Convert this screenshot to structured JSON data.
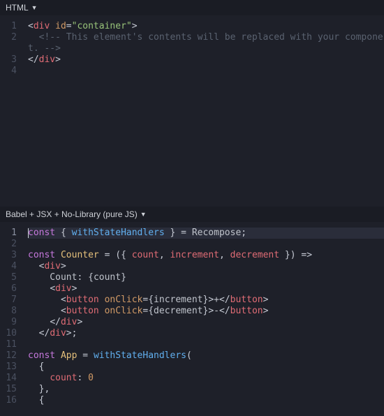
{
  "panel1": {
    "title": "HTML",
    "lines": [
      {
        "n": "1",
        "tokens": [
          [
            "t-punc",
            "<"
          ],
          [
            "t-tag",
            "div"
          ],
          [
            "t-plain",
            " "
          ],
          [
            "t-attr",
            "id"
          ],
          [
            "t-op",
            "="
          ],
          [
            "t-str",
            "\"container\""
          ],
          [
            "t-punc",
            ">"
          ]
        ]
      },
      {
        "n": "2",
        "tokens": [
          [
            "t-plain",
            "  "
          ],
          [
            "t-cmt",
            "<!-- This element's contents will be replaced with your componen"
          ]
        ]
      },
      {
        "n": "",
        "tokens": [
          [
            "t-cmt",
            "t. -->"
          ]
        ]
      },
      {
        "n": "3",
        "tokens": [
          [
            "t-punc",
            "</"
          ],
          [
            "t-tag",
            "div"
          ],
          [
            "t-punc",
            ">"
          ]
        ]
      },
      {
        "n": "4",
        "tokens": []
      }
    ]
  },
  "panel2": {
    "title": "Babel + JSX + No-Library (pure JS)",
    "lines": [
      {
        "n": "1",
        "active": true,
        "cursor": true,
        "tokens": [
          [
            "t-kw",
            "const"
          ],
          [
            "t-plain",
            " "
          ],
          [
            "t-punc",
            "{"
          ],
          [
            "t-plain",
            " "
          ],
          [
            "t-fn",
            "withStateHandlers"
          ],
          [
            "t-plain",
            " "
          ],
          [
            "t-punc",
            "}"
          ],
          [
            "t-plain",
            " "
          ],
          [
            "t-op",
            "="
          ],
          [
            "t-plain",
            " Recompose"
          ],
          [
            "t-punc",
            ";"
          ]
        ]
      },
      {
        "n": "2",
        "tokens": []
      },
      {
        "n": "3",
        "tokens": [
          [
            "t-kw",
            "const"
          ],
          [
            "t-plain",
            " "
          ],
          [
            "t-fn2",
            "Counter"
          ],
          [
            "t-plain",
            " "
          ],
          [
            "t-op",
            "="
          ],
          [
            "t-plain",
            " "
          ],
          [
            "t-punc",
            "({"
          ],
          [
            "t-plain",
            " "
          ],
          [
            "t-name",
            "count"
          ],
          [
            "t-punc",
            ","
          ],
          [
            "t-plain",
            " "
          ],
          [
            "t-name",
            "increment"
          ],
          [
            "t-punc",
            ","
          ],
          [
            "t-plain",
            " "
          ],
          [
            "t-name",
            "decrement"
          ],
          [
            "t-plain",
            " "
          ],
          [
            "t-punc",
            "})"
          ],
          [
            "t-plain",
            " "
          ],
          [
            "t-op",
            "=>"
          ]
        ]
      },
      {
        "n": "4",
        "tokens": [
          [
            "t-plain",
            "  "
          ],
          [
            "t-punc",
            "<"
          ],
          [
            "t-tag",
            "div"
          ],
          [
            "t-punc",
            ">"
          ]
        ]
      },
      {
        "n": "5",
        "tokens": [
          [
            "t-plain",
            "    Count"
          ],
          [
            "t-punc",
            ":"
          ],
          [
            "t-plain",
            " "
          ],
          [
            "t-punc",
            "{"
          ],
          [
            "t-plain",
            "count"
          ],
          [
            "t-punc",
            "}"
          ]
        ]
      },
      {
        "n": "6",
        "tokens": [
          [
            "t-plain",
            "    "
          ],
          [
            "t-punc",
            "<"
          ],
          [
            "t-tag",
            "div"
          ],
          [
            "t-punc",
            ">"
          ]
        ]
      },
      {
        "n": "7",
        "tokens": [
          [
            "t-plain",
            "      "
          ],
          [
            "t-punc",
            "<"
          ],
          [
            "t-tag",
            "button"
          ],
          [
            "t-plain",
            " "
          ],
          [
            "t-attr",
            "onClick"
          ],
          [
            "t-op",
            "="
          ],
          [
            "t-punc",
            "{"
          ],
          [
            "t-plain",
            "increment"
          ],
          [
            "t-punc",
            "}>"
          ],
          [
            "t-plain",
            "+"
          ],
          [
            "t-punc",
            "</"
          ],
          [
            "t-tag",
            "button"
          ],
          [
            "t-punc",
            ">"
          ]
        ]
      },
      {
        "n": "8",
        "tokens": [
          [
            "t-plain",
            "      "
          ],
          [
            "t-punc",
            "<"
          ],
          [
            "t-tag",
            "button"
          ],
          [
            "t-plain",
            " "
          ],
          [
            "t-attr",
            "onClick"
          ],
          [
            "t-op",
            "="
          ],
          [
            "t-punc",
            "{"
          ],
          [
            "t-plain",
            "decrement"
          ],
          [
            "t-punc",
            "}>"
          ],
          [
            "t-plain",
            "-"
          ],
          [
            "t-punc",
            "</"
          ],
          [
            "t-tag",
            "button"
          ],
          [
            "t-punc",
            ">"
          ]
        ]
      },
      {
        "n": "9",
        "tokens": [
          [
            "t-plain",
            "    "
          ],
          [
            "t-punc",
            "</"
          ],
          [
            "t-tag",
            "div"
          ],
          [
            "t-punc",
            ">"
          ]
        ]
      },
      {
        "n": "10",
        "tokens": [
          [
            "t-plain",
            "  "
          ],
          [
            "t-punc",
            "</"
          ],
          [
            "t-tag",
            "div"
          ],
          [
            "t-punc",
            ">;"
          ]
        ]
      },
      {
        "n": "11",
        "tokens": []
      },
      {
        "n": "12",
        "tokens": [
          [
            "t-kw",
            "const"
          ],
          [
            "t-plain",
            " "
          ],
          [
            "t-fn2",
            "App"
          ],
          [
            "t-plain",
            " "
          ],
          [
            "t-op",
            "="
          ],
          [
            "t-plain",
            " "
          ],
          [
            "t-fn",
            "withStateHandlers"
          ],
          [
            "t-punc",
            "("
          ]
        ]
      },
      {
        "n": "13",
        "tokens": [
          [
            "t-plain",
            "  "
          ],
          [
            "t-punc",
            "{"
          ]
        ]
      },
      {
        "n": "14",
        "tokens": [
          [
            "t-plain",
            "    "
          ],
          [
            "t-name",
            "count"
          ],
          [
            "t-punc",
            ":"
          ],
          [
            "t-plain",
            " "
          ],
          [
            "t-num",
            "0"
          ]
        ]
      },
      {
        "n": "15",
        "tokens": [
          [
            "t-plain",
            "  "
          ],
          [
            "t-punc",
            "},"
          ]
        ]
      },
      {
        "n": "16",
        "tokens": [
          [
            "t-plain",
            "  "
          ],
          [
            "t-punc",
            "{"
          ]
        ]
      }
    ]
  }
}
